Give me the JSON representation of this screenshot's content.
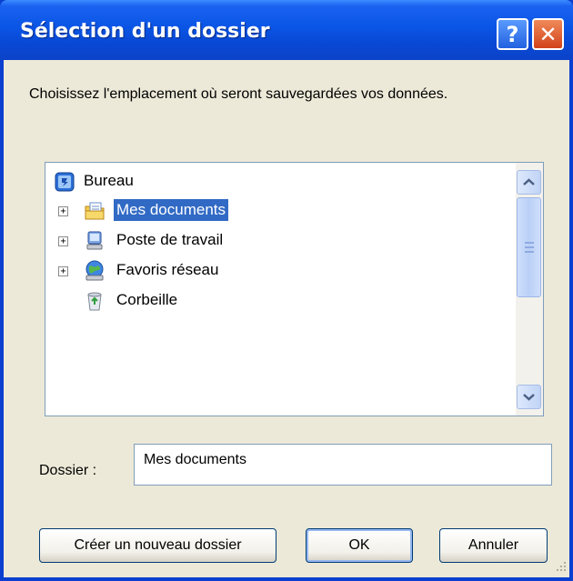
{
  "window": {
    "title": "Sélection d'un dossier",
    "help_label": "?",
    "close_label": "✕"
  },
  "dialog": {
    "instruction": "Choisissez l'emplacement où seront sauvegardées vos données."
  },
  "tree": {
    "root": {
      "label": "Bureau",
      "icon": "desktop-icon"
    },
    "items": [
      {
        "label": "Mes documents",
        "icon": "my-documents-folder-icon",
        "expandable": true,
        "selected": true
      },
      {
        "label": "Poste de travail",
        "icon": "my-computer-icon",
        "expandable": true,
        "selected": false
      },
      {
        "label": "Favoris réseau",
        "icon": "network-places-icon",
        "expandable": true,
        "selected": false
      },
      {
        "label": "Corbeille",
        "icon": "recycle-bin-icon",
        "expandable": false,
        "selected": false
      }
    ]
  },
  "folder_field": {
    "label": "Dossier :",
    "value": "Mes documents"
  },
  "buttons": {
    "new_folder": "Créer un nouveau dossier",
    "ok": "OK",
    "cancel": "Annuler"
  },
  "colors": {
    "titlebar": "#0a55e6",
    "selection": "#316ac5",
    "dialog_bg": "#ece9d8"
  }
}
